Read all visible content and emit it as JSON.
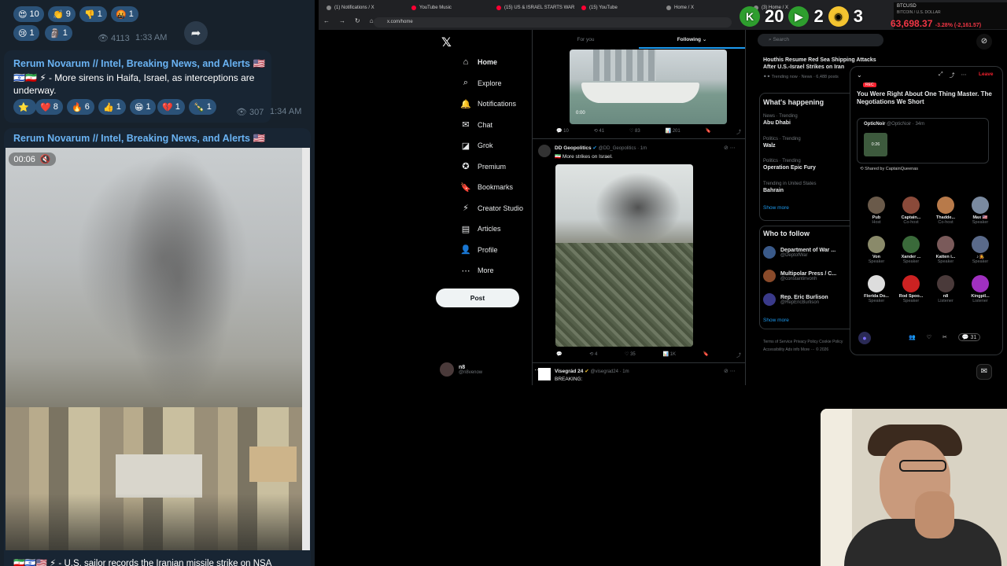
{
  "telegram": {
    "top_reactions": [
      {
        "emoji": "😍",
        "count": "10"
      },
      {
        "emoji": "👏",
        "count": "9"
      },
      {
        "emoji": "👎",
        "count": "1"
      },
      {
        "emoji": "🤬",
        "count": "1"
      },
      {
        "emoji": "😢",
        "count": "1"
      },
      {
        "emoji": "🗿",
        "count": "1"
      }
    ],
    "msg1_meta": {
      "views": "4113",
      "time": "1:33 AM"
    },
    "msg2": {
      "channel": "Rerum Novarum // Intel, Breaking News, and Alerts 🇺🇸",
      "text": "🇮🇱🇮🇷 ⚡ - More sirens in Haifa, Israel, as interceptions are underway.",
      "reactions": [
        {
          "emoji": "⭐",
          "count": ""
        },
        {
          "emoji": "❤️",
          "count": "8"
        },
        {
          "emoji": "🔥",
          "count": "6"
        },
        {
          "emoji": "👍",
          "count": "1"
        },
        {
          "emoji": "😁",
          "count": "1"
        },
        {
          "emoji": "💔",
          "count": "1"
        },
        {
          "emoji": "🍾",
          "count": "1"
        }
      ],
      "views": "307",
      "time": "1:34 AM"
    },
    "msg3": {
      "channel": "Rerum Novarum // Intel, Breaking News, and Alerts 🇺🇸",
      "video_time": "00:06",
      "caption": "🇮🇷🇮🇱🇺🇸 ⚡ - U.S. sailor records the Iranian missile strike on NSA"
    }
  },
  "browser": {
    "tabs": [
      {
        "label": "(1) Notifications / X",
        "color": "#888"
      },
      {
        "label": "YouTube Music",
        "color": "#f03"
      },
      {
        "label": "(15) US & ISRAEL STARTS WAR",
        "color": "#f03"
      },
      {
        "label": "(15) YouTube",
        "color": "#f03"
      },
      {
        "label": "Home / X",
        "color": "#888"
      },
      {
        "label": "(3) Home / X",
        "color": "#888"
      }
    ],
    "url": "x.com/home",
    "nav": [
      {
        "icon": "⌂",
        "label": "Home",
        "name": "home"
      },
      {
        "icon": "⌕",
        "label": "Explore",
        "name": "explore"
      },
      {
        "icon": "🔔",
        "label": "Notifications",
        "name": "notifications"
      },
      {
        "icon": "✉",
        "label": "Chat",
        "name": "chat"
      },
      {
        "icon": "◪",
        "label": "Grok",
        "name": "grok"
      },
      {
        "icon": "✪",
        "label": "Premium",
        "name": "premium"
      },
      {
        "icon": "🔖",
        "label": "Bookmarks",
        "name": "bookmarks"
      },
      {
        "icon": "⚡",
        "label": "Creator Studio",
        "name": "creator-studio"
      },
      {
        "icon": "▤",
        "label": "Articles",
        "name": "articles"
      },
      {
        "icon": "👤",
        "label": "Profile",
        "name": "profile"
      },
      {
        "icon": "⋯",
        "label": "More",
        "name": "more"
      }
    ],
    "post_button": "Post",
    "account": {
      "name": "n8",
      "handle": "@n8venow"
    },
    "feed_tabs": {
      "for_you": "For you",
      "following": "Following"
    },
    "post1_stats": {
      "replies": "10",
      "reposts": "41",
      "likes": "83",
      "views": "201"
    },
    "video_time": "0:00",
    "post2": {
      "author": "DD Geopolitics",
      "handle": "@DD_Geopolitics · 1m",
      "text": "🇮🇷 More strikes on Israel.",
      "replies": "",
      "reposts": "4",
      "likes": "35",
      "views": "1K"
    },
    "post3": {
      "author": "Visegrád 24",
      "handle": "@visegrad24 · 1m",
      "text": "BREAKING:"
    },
    "search_placeholder": "Search",
    "top_news": {
      "title": "Houthis Resume Red Sea Shipping Attacks After U.S.-Israel Strikes on Iran",
      "meta": "Trending now · News · 6,488 posts"
    },
    "happening_title": "What's happening",
    "trends": [
      {
        "meta": "News · Trending",
        "name": "Abu Dhabi"
      },
      {
        "meta": "Politics · Trending",
        "name": "Walz"
      },
      {
        "meta": "Politics · Trending",
        "name": "Operation Epic Fury"
      },
      {
        "meta": "Trending in United States",
        "name": "Bahrain"
      }
    ],
    "show_more": "Show more",
    "who_to_follow": "Who to follow",
    "follow": [
      {
        "name": "Department of War ...",
        "handle": "@DeptofWar"
      },
      {
        "name": "Multipolar Press / C...",
        "handle": "@constantinvonh"
      },
      {
        "name": "Rep. Eric Burlison",
        "handle": "@RepEricBurlison"
      }
    ],
    "footer": "Terms of Service  Privacy Policy  Cookie Policy  Accessibility  Ads info  More ···  © 2026",
    "space": {
      "rec": "REC",
      "leave": "Leave",
      "title": "You Were Right About One Thing Master. The Negotiations We Short",
      "host_name": "OpticNoir",
      "host_meta": "@OpticNoir · 34m",
      "clip_time": "0:26",
      "shared_by": "Shared by CaptainQueenas",
      "speakers": [
        {
          "name": "Pub",
          "role": "Host",
          "color": "#6a5a4a"
        },
        {
          "name": "Captain...",
          "role": "Co-host",
          "color": "#8a4a3a"
        },
        {
          "name": "Thadde...",
          "role": "Co-host",
          "color": "#b87a4a"
        },
        {
          "name": "Max 🇺🇸",
          "role": "Speaker",
          "color": "#7a8aa0"
        },
        {
          "name": "Von",
          "role": "Speaker",
          "color": "#8a8a6a"
        },
        {
          "name": "Xander ...",
          "role": "Speaker",
          "color": "#3a6a3a"
        },
        {
          "name": "Katten i...",
          "role": "Speaker",
          "color": "#7a5a5a"
        },
        {
          "name": "♪🧑‍🎤",
          "role": "Speaker",
          "color": "#5a6a8a"
        },
        {
          "name": "Florida Do...",
          "role": "Speaker",
          "color": "#ddd"
        },
        {
          "name": "Rod Spoo...",
          "role": "Speaker",
          "color": "#c22"
        },
        {
          "name": "n8",
          "role": "Listener",
          "color": "#4a3a3a"
        },
        {
          "name": "Kingpil...",
          "role": "Listener",
          "color": "#a030c0"
        }
      ],
      "comment_count": "31"
    }
  },
  "overlay": {
    "stat1": "20",
    "stat2": "2",
    "stat3": "3",
    "btc_label": "BTCUSD",
    "btc_sub": "BITCOIN / U.S. DOLLAR",
    "btc_price": "63,698.37",
    "btc_change": "-3.28% (-2,161.57)"
  }
}
